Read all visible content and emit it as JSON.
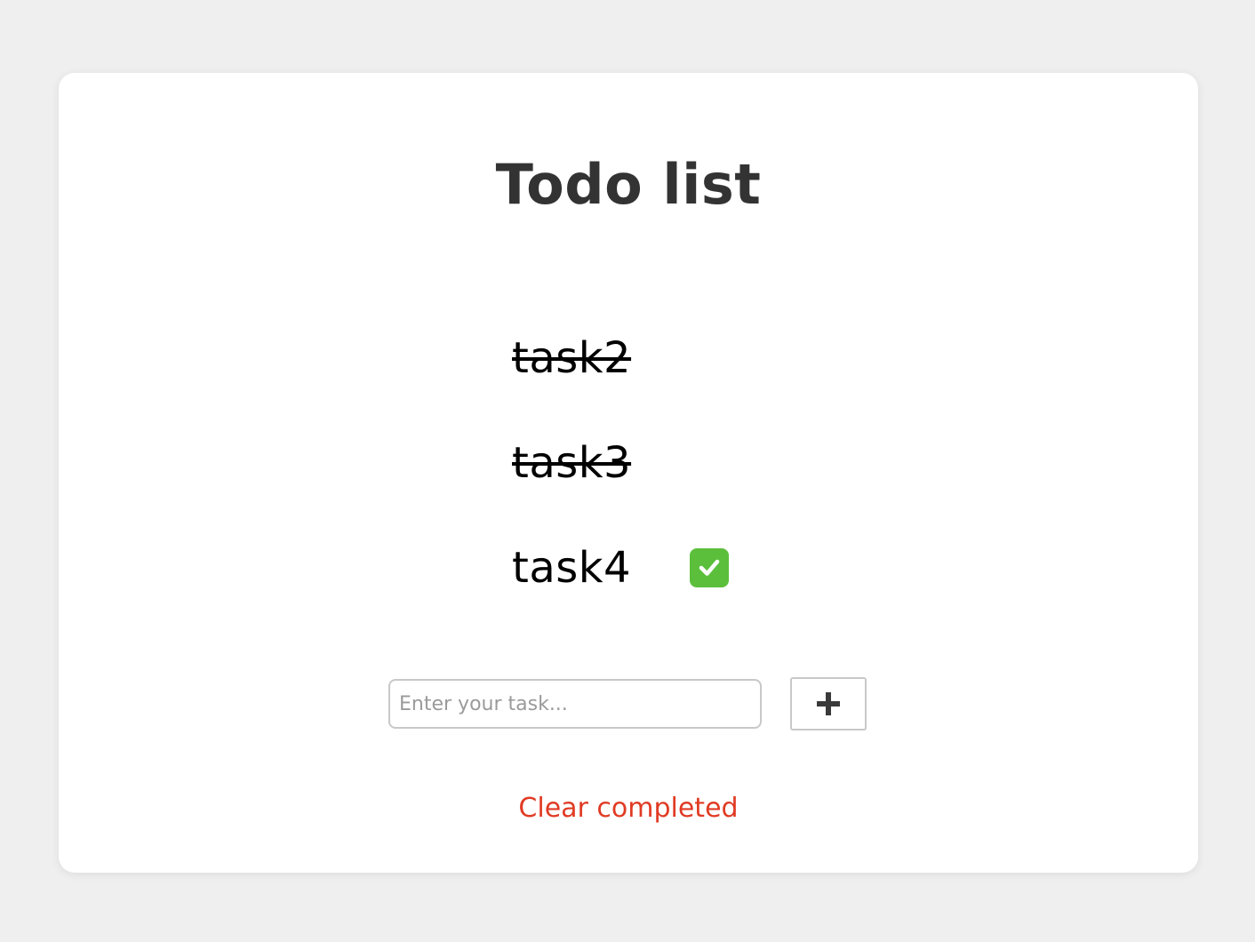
{
  "app": {
    "title": "Todo list"
  },
  "tasks": [
    {
      "label": "task2",
      "completed": true,
      "show_check": false
    },
    {
      "label": "task3",
      "completed": true,
      "show_check": false
    },
    {
      "label": "task4",
      "completed": false,
      "show_check": true
    }
  ],
  "new_task": {
    "value": "",
    "placeholder": "Enter your task..."
  },
  "add_button": {
    "icon": "plus-icon"
  },
  "clear_completed": {
    "label": "Clear completed"
  },
  "colors": {
    "background": "#efefef",
    "card": "#ffffff",
    "title": "#333333",
    "clear_link": "#e03b24",
    "check": "#5bbf3b"
  }
}
